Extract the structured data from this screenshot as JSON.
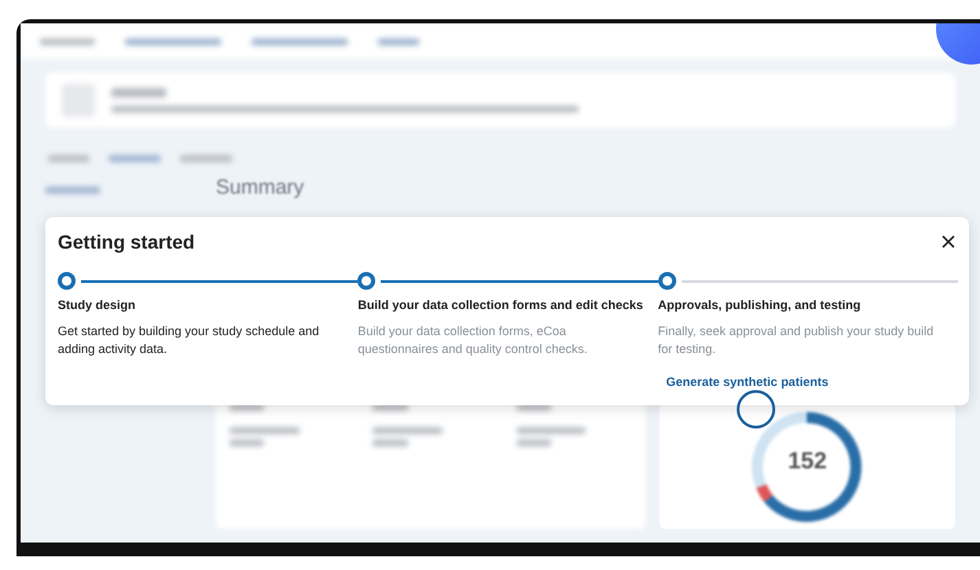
{
  "background": {
    "section_title": "Summary",
    "donut_value": "152"
  },
  "dialog": {
    "title": "Getting started",
    "steps": [
      {
        "title": "Study design",
        "description": "Get started by building your study schedule and adding activity data.",
        "current": true,
        "line_done": true
      },
      {
        "title": "Build your data collection forms and edit checks",
        "description": "Build your data collection forms, eCoa questionnaires and quality control checks.",
        "current": false,
        "line_done": true
      },
      {
        "title": "Approvals, publishing, and testing",
        "description": "Finally, seek approval and publish your study build for testing.",
        "current": false,
        "line_done": false,
        "link": "Generate synthetic patients"
      }
    ]
  }
}
